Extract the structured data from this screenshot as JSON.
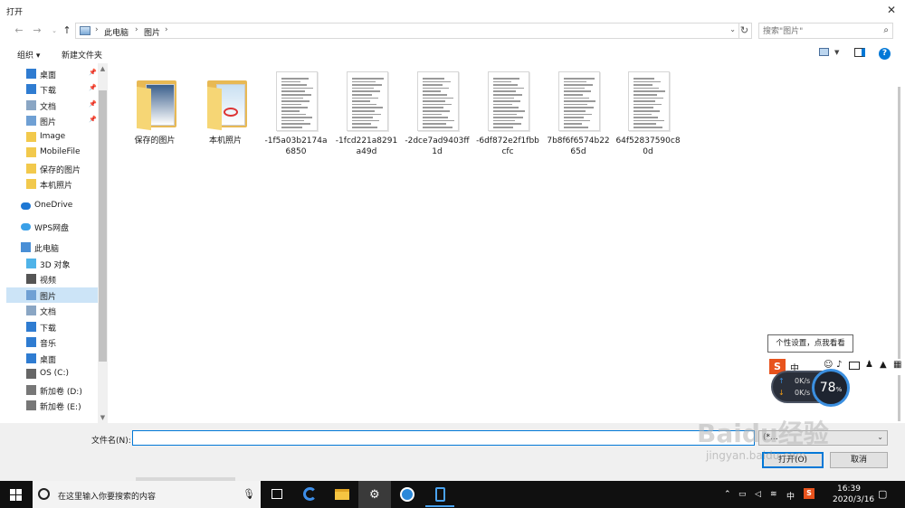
{
  "window": {
    "title": "打开",
    "close_icon": "close-icon"
  },
  "address": {
    "segments": [
      "此电脑",
      "图片"
    ],
    "search_placeholder": "搜索\"图片\""
  },
  "toolbar": {
    "organize": "组织 ▾",
    "new_folder": "新建文件夹"
  },
  "nav": {
    "items": [
      {
        "label": "桌面",
        "icon": "desktop-icon",
        "pinned": true
      },
      {
        "label": "下载",
        "icon": "download-icon",
        "pinned": true
      },
      {
        "label": "文档",
        "icon": "document-icon",
        "pinned": true
      },
      {
        "label": "图片",
        "icon": "pictures-icon",
        "pinned": true
      },
      {
        "label": "Image",
        "icon": "folder-icon"
      },
      {
        "label": "MobileFile",
        "icon": "folder-icon"
      },
      {
        "label": "保存的图片",
        "icon": "folder-icon"
      },
      {
        "label": "本机照片",
        "icon": "folder-icon"
      },
      {
        "label": "OneDrive",
        "icon": "onedrive-icon"
      },
      {
        "label": "WPS网盘",
        "icon": "wps-cloud-icon"
      },
      {
        "label": "此电脑",
        "icon": "this-pc-icon"
      },
      {
        "label": "3D 对象",
        "icon": "3d-objects-icon"
      },
      {
        "label": "视频",
        "icon": "video-icon"
      },
      {
        "label": "图片",
        "icon": "pictures-icon",
        "selected": true
      },
      {
        "label": "文档",
        "icon": "document-icon"
      },
      {
        "label": "下载",
        "icon": "download-icon"
      },
      {
        "label": "音乐",
        "icon": "music-icon"
      },
      {
        "label": "桌面",
        "icon": "desktop-icon"
      },
      {
        "label": "OS (C:)",
        "icon": "drive-c-icon"
      },
      {
        "label": "新加卷 (D:)",
        "icon": "drive-icon"
      },
      {
        "label": "新加卷 (E:)",
        "icon": "drive-icon"
      }
    ]
  },
  "files": [
    {
      "name": "保存的图片",
      "kind": "folder"
    },
    {
      "name": "本机照片",
      "kind": "folder"
    },
    {
      "name": "-1f5a03b2174a6850",
      "kind": "doc"
    },
    {
      "name": "-1fcd221a8291a49d",
      "kind": "doc"
    },
    {
      "name": "-2dce7ad9403ff1d",
      "kind": "doc"
    },
    {
      "name": "-6df872e2f1fbbcfc",
      "kind": "doc"
    },
    {
      "name": "7b8f6f6574b2265d",
      "kind": "doc"
    },
    {
      "name": "64f52837590c80d",
      "kind": "doc"
    }
  ],
  "bottom": {
    "filename_label": "文件名(N):",
    "filename_value": "",
    "filetype_value": "(*...",
    "open_button": "打开(O)",
    "cancel_button": "取消"
  },
  "taskbar": {
    "search_text": "在这里输入你要搜索的内容",
    "time": "16:39",
    "date": "2020/3/16",
    "ime_mode": "中"
  },
  "overlay": {
    "tooltip": "个性设置，点我看看",
    "up_speed": "0K/s",
    "down_speed": "0K/s",
    "gauge": "78",
    "gauge_unit": "%"
  },
  "watermark": {
    "brand": "Baidu经验",
    "url": "jingyan.baidu.com"
  },
  "colors": {
    "accent": "#0078d7",
    "folder": "#e8b954",
    "selected": "#cce4f7",
    "taskbar": "#101010"
  }
}
